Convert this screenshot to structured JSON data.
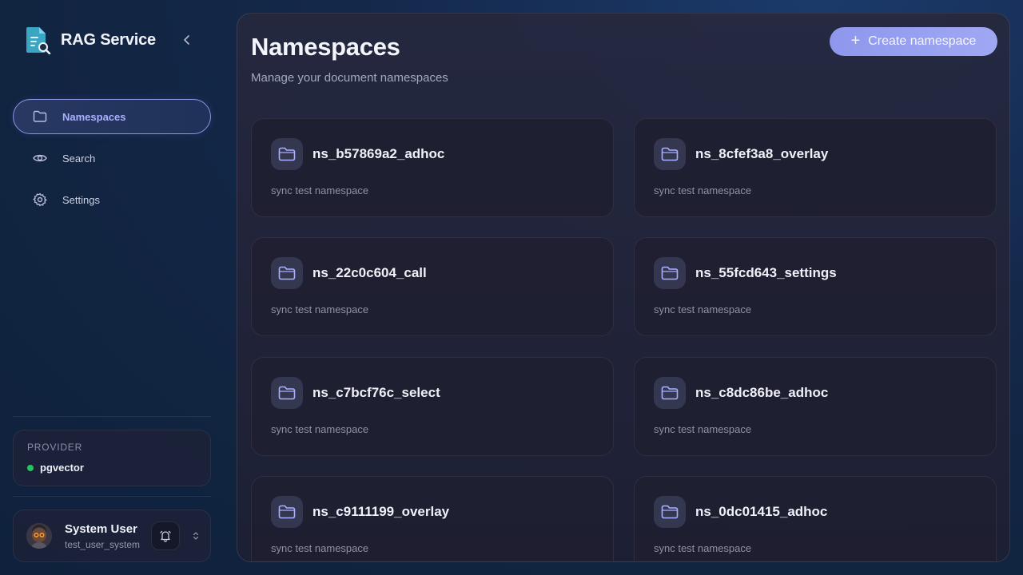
{
  "brand": {
    "title": "RAG Service"
  },
  "nav": {
    "items": [
      {
        "label": "Namespaces",
        "icon": "folder-icon",
        "active": true
      },
      {
        "label": "Search",
        "icon": "eye-icon",
        "active": false
      },
      {
        "label": "Settings",
        "icon": "gear-icon",
        "active": false
      }
    ]
  },
  "provider": {
    "label": "PROVIDER",
    "name": "pgvector",
    "status_color": "#22c55e"
  },
  "user": {
    "name": "System User",
    "email": "test_user_system"
  },
  "main": {
    "title": "Namespaces",
    "subtitle": "Manage your document namespaces",
    "create_label": "Create namespace",
    "namespaces": [
      {
        "name": "ns_b57869a2_adhoc",
        "description": "sync test namespace"
      },
      {
        "name": "ns_8cfef3a8_overlay",
        "description": "sync test namespace"
      },
      {
        "name": "ns_22c0c604_call",
        "description": "sync test namespace"
      },
      {
        "name": "ns_55fcd643_settings",
        "description": "sync test namespace"
      },
      {
        "name": "ns_c7bcf76c_select",
        "description": "sync test namespace"
      },
      {
        "name": "ns_c8dc86be_adhoc",
        "description": "sync test namespace"
      },
      {
        "name": "ns_c9111199_overlay",
        "description": "sync test namespace"
      },
      {
        "name": "ns_0dc01415_adhoc",
        "description": "sync test namespace"
      }
    ]
  },
  "colors": {
    "accent": "#a9b0ff",
    "button": "#9aa2f1"
  }
}
